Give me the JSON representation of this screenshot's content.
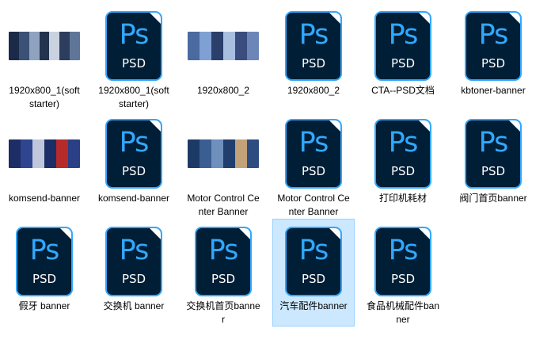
{
  "files": [
    {
      "name": "1920x800_1(soft starter)",
      "type": "image",
      "theme": "dark-blue"
    },
    {
      "name": "1920x800_1(soft starter)",
      "type": "psd"
    },
    {
      "name": "1920x800_2",
      "type": "image",
      "theme": "city"
    },
    {
      "name": "1920x800_2",
      "type": "psd"
    },
    {
      "name": "CTA--PSD文档",
      "type": "psd"
    },
    {
      "name": "kbtoner-banner",
      "type": "psd"
    },
    {
      "name": "komsend-banner",
      "type": "image",
      "theme": "navy-red"
    },
    {
      "name": "komsend-banner",
      "type": "psd"
    },
    {
      "name": "Motor Control Center Banner",
      "type": "image",
      "theme": "city-blue"
    },
    {
      "name": "Motor Control Center Banner",
      "type": "psd"
    },
    {
      "name": "打印机耗材",
      "type": "psd"
    },
    {
      "name": "阀门首页banner",
      "type": "psd"
    },
    {
      "name": "假牙 banner",
      "type": "psd"
    },
    {
      "name": "交换机 banner",
      "type": "psd"
    },
    {
      "name": "交换机首页banner",
      "type": "psd"
    },
    {
      "name": "汽车配件banner",
      "type": "psd",
      "selected": true
    },
    {
      "name": "食品机械配件banner",
      "type": "psd"
    }
  ],
  "psd_icon": {
    "logo": "Ps",
    "tag": "PSD",
    "bg_color": "#001e36",
    "accent_color": "#31a8ff"
  },
  "selection_colors": {
    "background": "#cce8ff",
    "border": "#99d1ff"
  }
}
